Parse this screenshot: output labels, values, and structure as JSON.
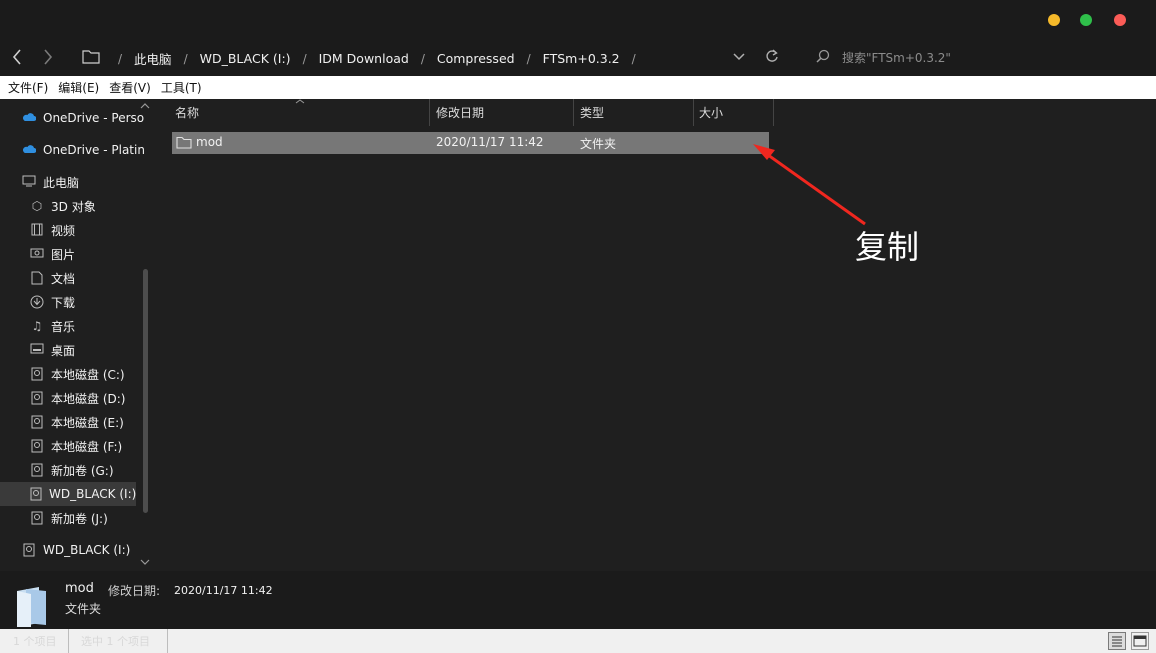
{
  "window": {
    "controls": {
      "minimize_color": "#f5b92a",
      "maximize_color": "#2fbf4a",
      "close_color": "#fb5c57"
    }
  },
  "address": {
    "back_icon": "chevron-left-icon",
    "forward_icon": "chevron-right-icon",
    "folder_icon": "folder-icon",
    "breadcrumbs": [
      "此电脑",
      "WD_BLACK (I:)",
      "IDM Download",
      "Compressed",
      "FTSm+0.3.2"
    ],
    "search_placeholder": "搜索\"FTSm+0.3.2\""
  },
  "menu": [
    "文件(F)",
    "编辑(E)",
    "查看(V)",
    "工具(T)"
  ],
  "sidebar": {
    "items": [
      {
        "label": "OneDrive - Perso",
        "icon": "cloud-icon"
      },
      {
        "label": "OneDrive - Platin",
        "icon": "cloud-icon"
      },
      {
        "label": "此电脑",
        "icon": "computer-icon"
      },
      {
        "label": "3D 对象",
        "icon": "cube-icon"
      },
      {
        "label": "视频",
        "icon": "video-icon"
      },
      {
        "label": "图片",
        "icon": "image-icon"
      },
      {
        "label": "文档",
        "icon": "document-icon"
      },
      {
        "label": "下载",
        "icon": "download-icon"
      },
      {
        "label": "音乐",
        "icon": "music-icon"
      },
      {
        "label": "桌面",
        "icon": "desktop-icon"
      },
      {
        "label": "本地磁盘 (C:)",
        "icon": "drive-icon"
      },
      {
        "label": "本地磁盘 (D:)",
        "icon": "drive-icon"
      },
      {
        "label": "本地磁盘 (E:)",
        "icon": "drive-icon"
      },
      {
        "label": "本地磁盘 (F:)",
        "icon": "drive-icon"
      },
      {
        "label": "新加卷 (G:)",
        "icon": "drive-icon"
      },
      {
        "label": "WD_BLACK (I:)",
        "icon": "drive-icon",
        "selected": true
      },
      {
        "label": "新加卷 (J:)",
        "icon": "drive-icon"
      },
      {
        "label": "WD_BLACK (I:)",
        "icon": "drive-icon"
      }
    ]
  },
  "columns": [
    "名称",
    "修改日期",
    "类型",
    "大小"
  ],
  "files": [
    {
      "name": "mod",
      "modified": "2020/11/17 11:42",
      "type": "文件夹",
      "size": "",
      "selected": true
    }
  ],
  "annotation": {
    "text": "复制",
    "color": "#f0271f"
  },
  "details": {
    "name": "mod",
    "modified_label": "修改日期:",
    "modified": "2020/11/17 11:42",
    "type": "文件夹"
  },
  "status": {
    "count": "1 个项目",
    "selected": "选中 1 个项目"
  }
}
